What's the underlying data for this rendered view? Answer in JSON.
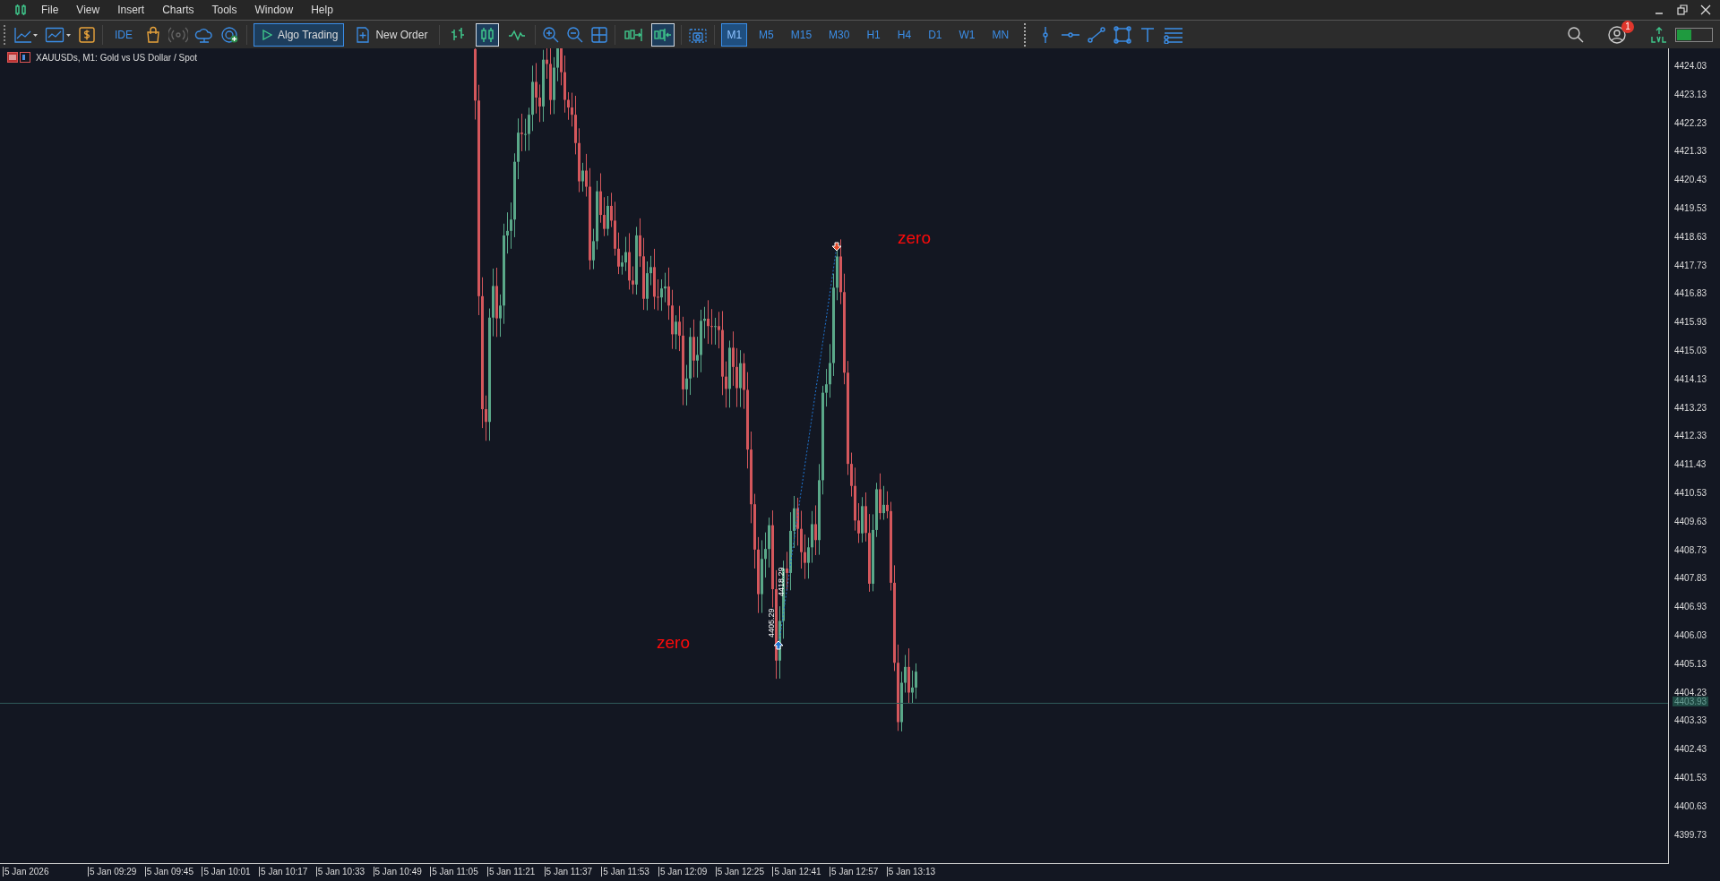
{
  "menu": [
    "File",
    "View",
    "Insert",
    "Charts",
    "Tools",
    "Window",
    "Help"
  ],
  "toolbar": {
    "ide": "IDE",
    "algo_trading": {
      "label": "Algo Trading",
      "on": true
    },
    "new_order": "New Order",
    "chart_types": [
      {
        "kind": "bars",
        "selected": false
      },
      {
        "kind": "candles",
        "selected": true
      },
      {
        "kind": "line",
        "selected": false
      }
    ],
    "auto_scroll": {
      "on": false
    },
    "chart_shift": {
      "on": true
    },
    "timeframes": [
      {
        "label": "M1",
        "selected": true
      },
      {
        "label": "M5",
        "selected": false
      },
      {
        "label": "M15",
        "selected": false
      },
      {
        "label": "M30",
        "selected": false
      },
      {
        "label": "H1",
        "selected": false
      },
      {
        "label": "H4",
        "selected": false
      },
      {
        "label": "D1",
        "selected": false
      },
      {
        "label": "W1",
        "selected": false
      },
      {
        "label": "MN",
        "selected": false
      }
    ]
  },
  "notifications": {
    "count": "1"
  },
  "chart": {
    "title": "XAUUSDs, M1:  Gold vs US Dollar / Spot",
    "price_ticks": [
      "4424.03",
      "4423.13",
      "4422.23",
      "4421.33",
      "4420.43",
      "4419.53",
      "4418.63",
      "4417.73",
      "4416.83",
      "4415.93",
      "4415.03",
      "4414.13",
      "4413.23",
      "4412.33",
      "4411.43",
      "4410.53",
      "4409.63",
      "4408.73",
      "4407.83",
      "4406.93",
      "4406.03",
      "4405.13",
      "4404.23",
      "4403.33",
      "4402.43",
      "4401.53",
      "4400.63",
      "4399.73"
    ],
    "current_price": "4403.93",
    "time_ticks": [
      "5 Jan 2026",
      "5 Jan 09:29",
      "5 Jan 09:45",
      "5 Jan 10:01",
      "5 Jan 10:17",
      "5 Jan 10:33",
      "5 Jan 10:49",
      "5 Jan 11:05",
      "5 Jan 11:21",
      "5 Jan 11:37",
      "5 Jan 11:53",
      "5 Jan 12:09",
      "5 Jan 12:25",
      "5 Jan 12:41",
      "5 Jan 12:57",
      "5 Jan 13:13"
    ],
    "annotations": [
      "zero",
      "zero"
    ],
    "trade_labels": [
      "4405.29",
      "4418.29"
    ]
  }
}
